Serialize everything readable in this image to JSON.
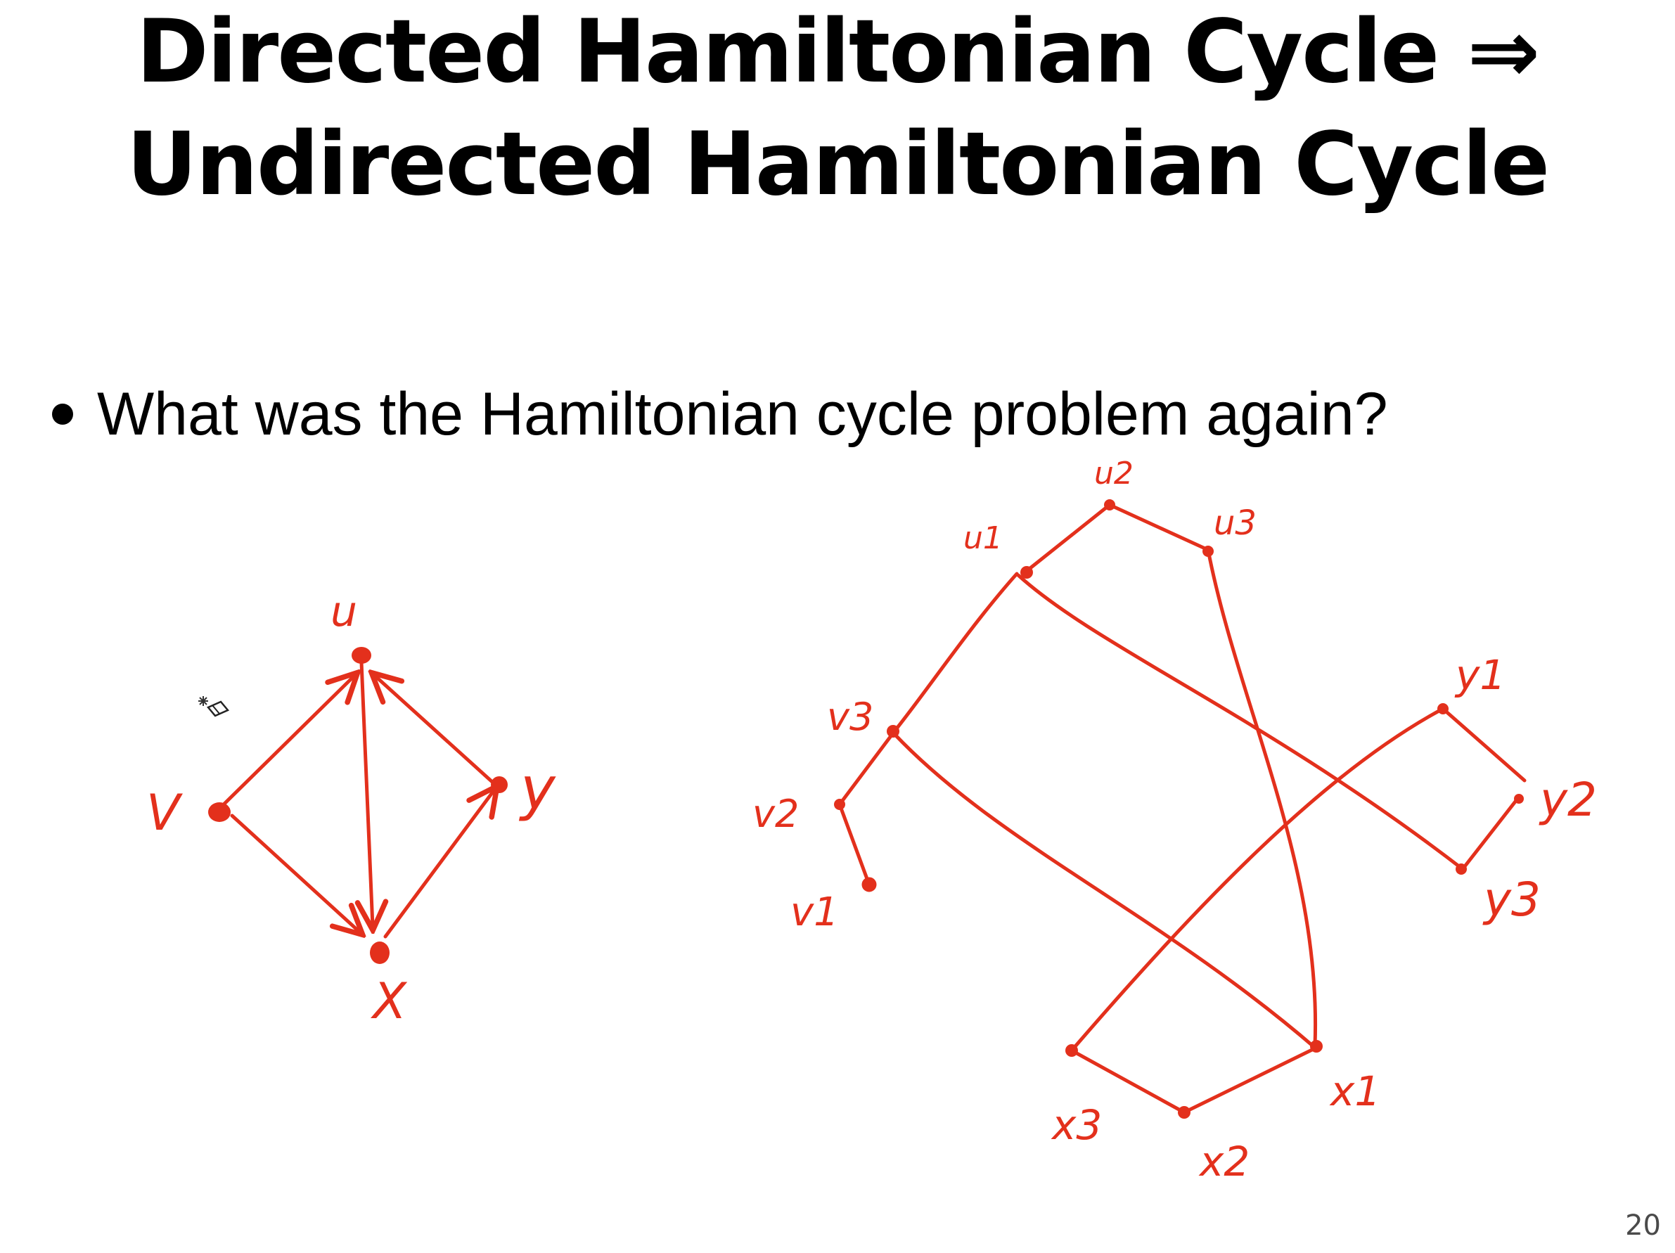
{
  "slide": {
    "title_line_1": "Directed Hamiltonian Cycle ⇒",
    "title_line_2": "Undirected Hamiltonian Cycle",
    "bullet": "What was the Hamiltonian cycle problem again?",
    "page_number": "20"
  },
  "annotation": {
    "ink_color": "#e3301c",
    "directed_graph_labels": {
      "u": "u",
      "v": "V",
      "x": "X",
      "y": "y"
    },
    "undirected_graph_labels": {
      "u1": "u1",
      "u2": "u2",
      "u3": "u3",
      "v1": "v1",
      "v2": "v2",
      "v3": "v3",
      "x1": "x1",
      "x2": "x2",
      "x3": "x3",
      "y1": "y1",
      "y2": "y2",
      "y3": "y3"
    }
  },
  "cursor": {
    "icon": "eraser-icon"
  }
}
